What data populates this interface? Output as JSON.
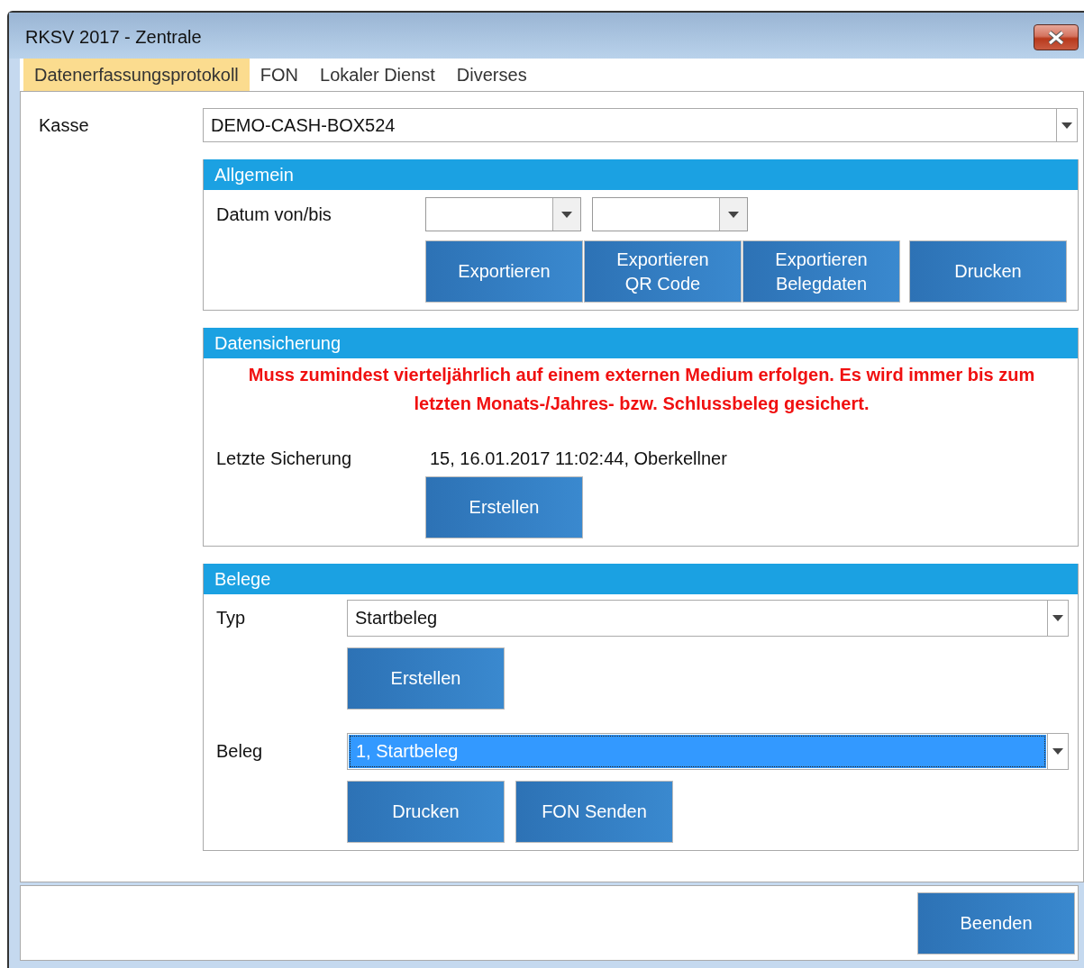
{
  "window": {
    "title": "RKSV 2017 - Zentrale"
  },
  "tabs": [
    {
      "label": "Datenerfassungsprotokoll",
      "selected": true
    },
    {
      "label": "FON",
      "selected": false
    },
    {
      "label": "Lokaler Dienst",
      "selected": false
    },
    {
      "label": "Diverses",
      "selected": false
    }
  ],
  "kasse": {
    "label": "Kasse",
    "value": "DEMO-CASH-BOX524"
  },
  "allgemein": {
    "title": "Allgemein",
    "date_label": "Datum von/bis",
    "buttons": [
      {
        "lines": [
          "Exportieren"
        ]
      },
      {
        "lines": [
          "Exportieren",
          "QR Code"
        ]
      },
      {
        "lines": [
          "Exportieren",
          "Belegdaten"
        ]
      },
      {
        "lines": [
          "Drucken"
        ]
      }
    ]
  },
  "datensicherung": {
    "title": "Datensicherung",
    "notice": "Muss zumindest vierteljährlich auf einem externen Medium erfolgen. Es wird immer bis zum letzten Monats-/Jahres- bzw. Schlussbeleg gesichert.",
    "last_label": "Letzte Sicherung",
    "last_value": "15, 16.01.2017 11:02:44, Oberkellner",
    "button": "Erstellen"
  },
  "belege": {
    "title": "Belege",
    "typ_label": "Typ",
    "typ_value": "Startbeleg",
    "create_button": "Erstellen",
    "beleg_label": "Beleg",
    "beleg_value": "1, Startbeleg",
    "beleg_focused": true,
    "buttons": [
      "Drucken",
      "FON Senden"
    ]
  },
  "footer": {
    "button": "Beenden"
  }
}
